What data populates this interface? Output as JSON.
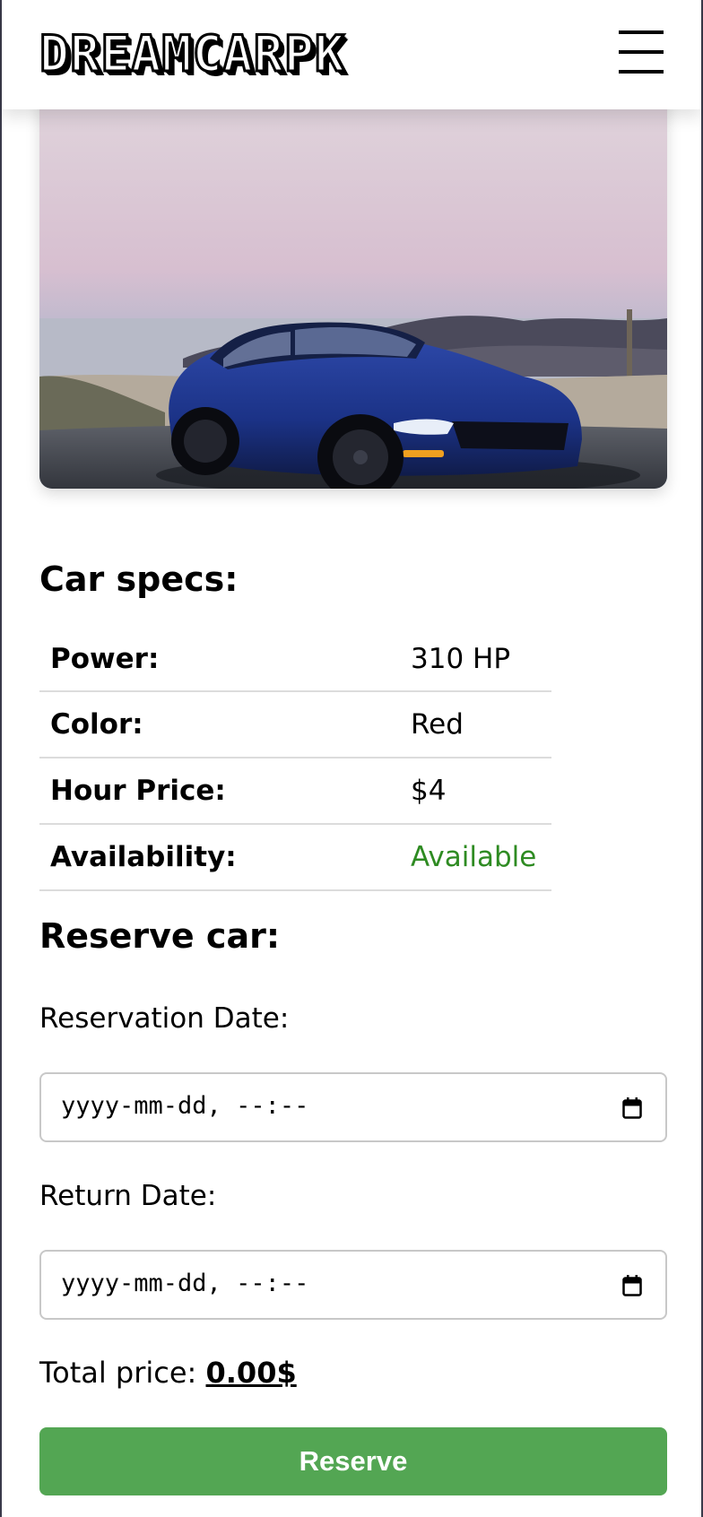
{
  "header": {
    "logo_text": "DREAMCARPK"
  },
  "car": {
    "image_alt": "Blue Ford Mustang parked by the beach at dusk"
  },
  "specs": {
    "title": "Car specs:",
    "rows": [
      {
        "label": "Power:",
        "value": "310 HP"
      },
      {
        "label": "Color:",
        "value": "Red"
      },
      {
        "label": "Hour Price:",
        "value": "$4"
      },
      {
        "label": "Availability:",
        "value": "Available"
      }
    ],
    "availability_color": "#2e8b22"
  },
  "reserve": {
    "title": "Reserve car:",
    "reservation_label": "Reservation Date:",
    "reservation_placeholder": "yyyy-mm-dd, --:--",
    "return_label": "Return Date:",
    "return_placeholder": "yyyy-mm-dd, --:--",
    "total_label": "Total price:",
    "total_value": "0.00$",
    "button_label": "Reserve",
    "button_color": "#53a653"
  }
}
